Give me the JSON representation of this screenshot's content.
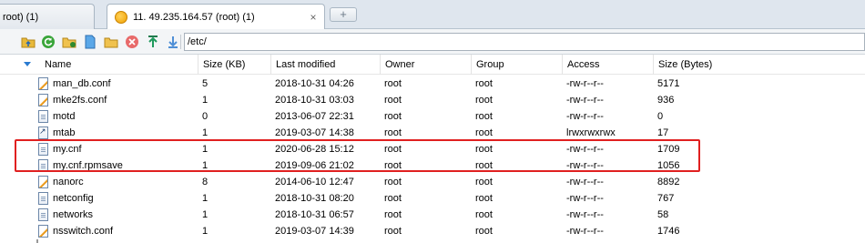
{
  "tabs": [
    {
      "label": "root) (1)",
      "active": false
    },
    {
      "label": "11. 49.235.164.57 (root) (1)",
      "active": true,
      "close": "×"
    }
  ],
  "new_tab": {
    "label": "+"
  },
  "toolbar": {
    "icons": [
      "upload-folder-icon",
      "refresh-icon",
      "folder-open-icon",
      "new-file-icon",
      "new-folder-icon",
      "delete-icon",
      "upload-icon",
      "download-icon"
    ],
    "path": "/etc/"
  },
  "columns": {
    "name": "Name",
    "size_kb": "Size (KB)",
    "modified": "Last modified",
    "owner": "Owner",
    "group": "Group",
    "access": "Access",
    "size_bytes": "Size (Bytes)"
  },
  "files": [
    {
      "name": "man_db.conf",
      "type": "conf",
      "size_kb": "5",
      "modified": "2018-10-31 04:26",
      "owner": "root",
      "group": "root",
      "access": "-rw-r--r--",
      "size_bytes": "5171"
    },
    {
      "name": "mke2fs.conf",
      "type": "conf",
      "size_kb": "1",
      "modified": "2018-10-31 03:03",
      "owner": "root",
      "group": "root",
      "access": "-rw-r--r--",
      "size_bytes": "936"
    },
    {
      "name": "motd",
      "type": "doc",
      "size_kb": "0",
      "modified": "2013-06-07 22:31",
      "owner": "root",
      "group": "root",
      "access": "-rw-r--r--",
      "size_bytes": "0"
    },
    {
      "name": "mtab",
      "type": "link",
      "size_kb": "1",
      "modified": "2019-03-07 14:38",
      "owner": "root",
      "group": "root",
      "access": "lrwxrwxrwx",
      "size_bytes": "17"
    },
    {
      "name": "my.cnf",
      "type": "doc",
      "size_kb": "1",
      "modified": "2020-06-28 15:12",
      "owner": "root",
      "group": "root",
      "access": "-rw-r--r--",
      "size_bytes": "1709"
    },
    {
      "name": "my.cnf.rpmsave",
      "type": "doc",
      "size_kb": "1",
      "modified": "2019-09-06 21:02",
      "owner": "root",
      "group": "root",
      "access": "-rw-r--r--",
      "size_bytes": "1056"
    },
    {
      "name": "nanorc",
      "type": "conf",
      "size_kb": "8",
      "modified": "2014-06-10 12:47",
      "owner": "root",
      "group": "root",
      "access": "-rw-r--r--",
      "size_bytes": "8892"
    },
    {
      "name": "netconfig",
      "type": "doc",
      "size_kb": "1",
      "modified": "2018-10-31 08:20",
      "owner": "root",
      "group": "root",
      "access": "-rw-r--r--",
      "size_bytes": "767"
    },
    {
      "name": "networks",
      "type": "doc",
      "size_kb": "1",
      "modified": "2018-10-31 06:57",
      "owner": "root",
      "group": "root",
      "access": "-rw-r--r--",
      "size_bytes": "58"
    },
    {
      "name": "nsswitch.conf",
      "type": "conf",
      "size_kb": "1",
      "modified": "2019-03-07 14:39",
      "owner": "root",
      "group": "root",
      "access": "-rw-r--r--",
      "size_bytes": "1746"
    }
  ],
  "highlight_color": "#e02020"
}
